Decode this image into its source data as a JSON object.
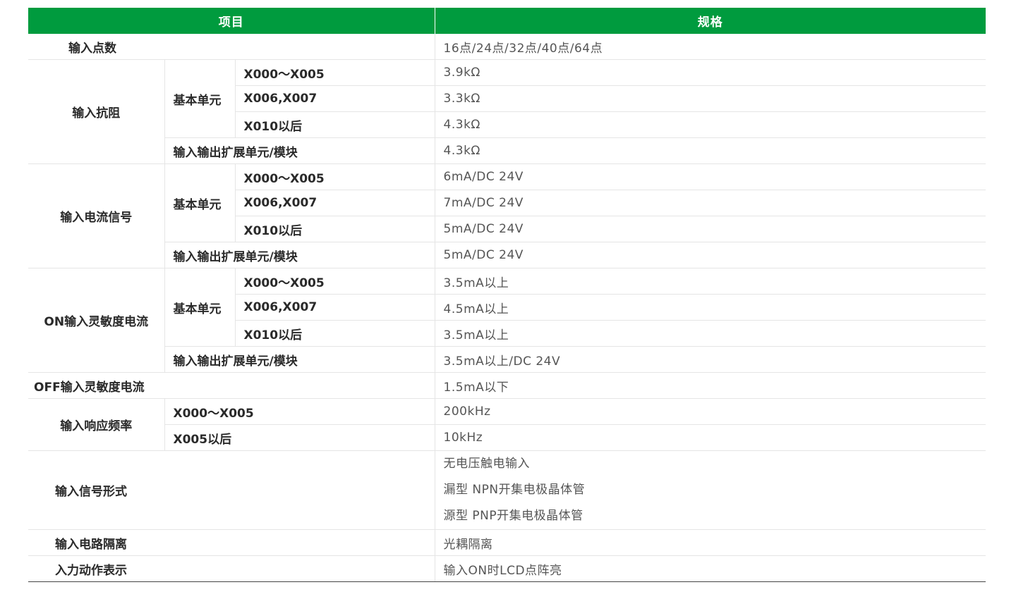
{
  "header": {
    "item": "项目",
    "spec": "规格"
  },
  "rows": {
    "input_points": {
      "label": "输入点数",
      "value": "16点/24点/32点/40点/64点"
    },
    "impedance": {
      "label": "输入抗阻",
      "basic": "基本单元",
      "r1": {
        "sub": "X000～X005",
        "value": "3.9kΩ"
      },
      "r2": {
        "sub": "X006,X007",
        "value": "3.3kΩ"
      },
      "r3": {
        "sub": "X010以后",
        "value": "4.3kΩ"
      },
      "ext": {
        "label": "输入输出扩展单元/模块",
        "value": "4.3kΩ"
      }
    },
    "current": {
      "label": "输入电流信号",
      "basic": "基本单元",
      "r1": {
        "sub": "X000～X005",
        "value": "6mA/DC 24V"
      },
      "r2": {
        "sub": "X006,X007",
        "value": "7mA/DC 24V"
      },
      "r3": {
        "sub": "X010以后",
        "value": "5mA/DC 24V"
      },
      "ext": {
        "label": "输入输出扩展单元/模块",
        "value": "5mA/DC 24V"
      }
    },
    "on_sens": {
      "label": "ON输入灵敏度电流",
      "basic": "基本单元",
      "r1": {
        "sub": "X000～X005",
        "value": "3.5mA以上"
      },
      "r2": {
        "sub": "X006,X007",
        "value": "4.5mA以上"
      },
      "r3": {
        "sub": "X010以后",
        "value": "3.5mA以上"
      },
      "ext": {
        "label": "输入输出扩展单元/模块",
        "value": "3.5mA以上/DC 24V"
      }
    },
    "off_sens": {
      "label": "OFF输入灵敏度电流",
      "value": "1.5mA以下"
    },
    "response": {
      "label": "输入响应频率",
      "r1": {
        "sub": "X000～X005",
        "value": "200kHz"
      },
      "r2": {
        "sub": "X005以后",
        "value": "10kHz"
      }
    },
    "signal_form": {
      "label": "输入信号形式",
      "values": [
        "无电压触电输入",
        "漏型 NPN开集电极晶体管",
        "源型 PNP开集电极晶体管"
      ]
    },
    "isolation": {
      "label": "输入电路隔离",
      "value": "光耦隔离"
    },
    "display": {
      "label": "入力动作表示",
      "value": "输入ON时LCD点阵亮"
    }
  }
}
